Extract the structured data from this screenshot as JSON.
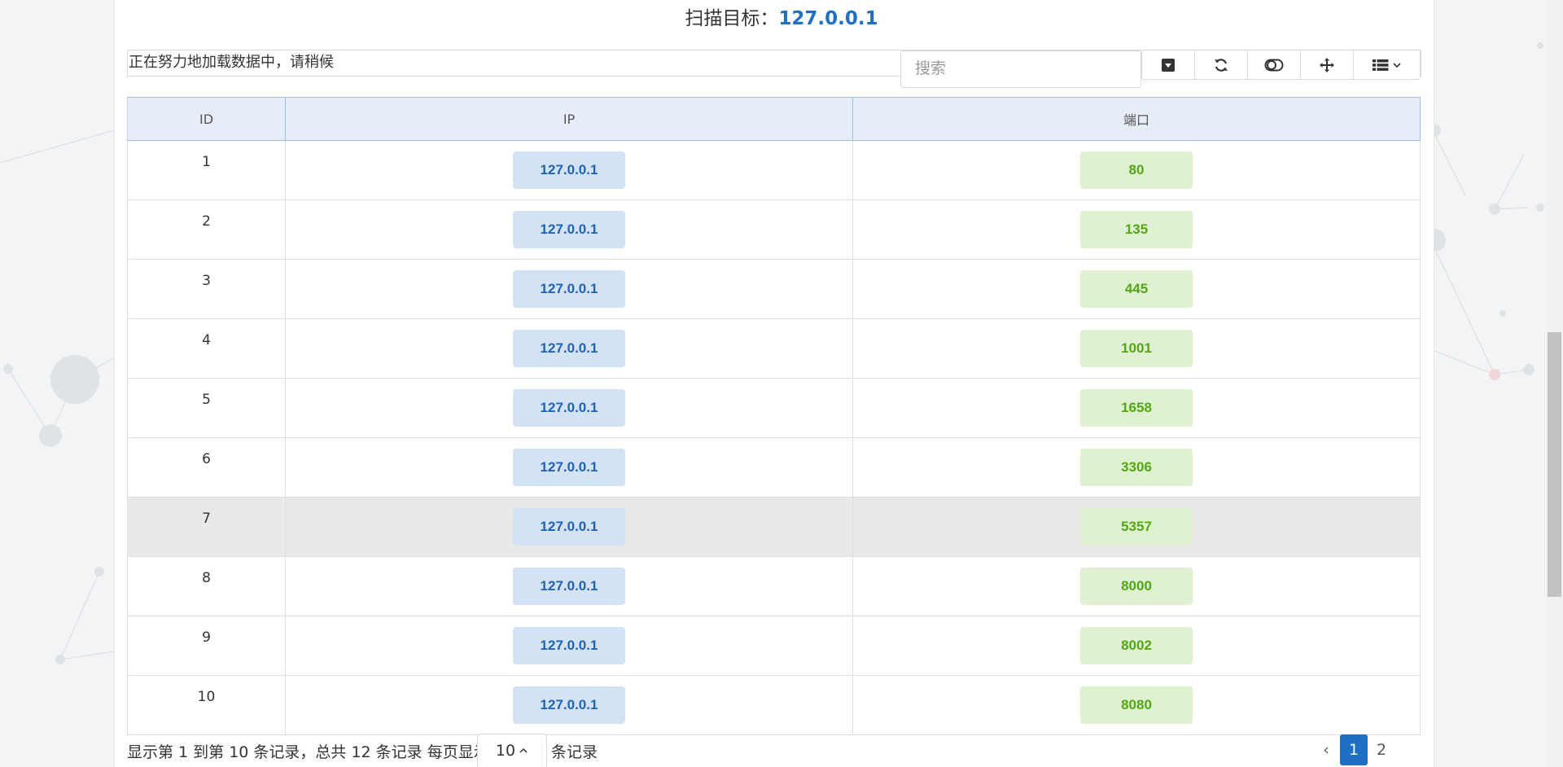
{
  "header": {
    "title_prefix": "扫描目标：",
    "title_target": "127.0.0.1"
  },
  "loading_text": "正在努力地加载数据中，请稍候",
  "search": {
    "placeholder": "搜索"
  },
  "toolbar": {
    "buttons": [
      "caret-square-down-icon",
      "refresh-icon",
      "toggle-icon",
      "move-icon",
      "columns-list-icon"
    ]
  },
  "table": {
    "headers": [
      "ID",
      "IP",
      "端口"
    ],
    "rows": [
      {
        "id": "1",
        "ip": "127.0.0.1",
        "port": "80"
      },
      {
        "id": "2",
        "ip": "127.0.0.1",
        "port": "135"
      },
      {
        "id": "3",
        "ip": "127.0.0.1",
        "port": "445"
      },
      {
        "id": "4",
        "ip": "127.0.0.1",
        "port": "1001"
      },
      {
        "id": "5",
        "ip": "127.0.0.1",
        "port": "1658"
      },
      {
        "id": "6",
        "ip": "127.0.0.1",
        "port": "3306"
      },
      {
        "id": "7",
        "ip": "127.0.0.1",
        "port": "5357"
      },
      {
        "id": "8",
        "ip": "127.0.0.1",
        "port": "8000"
      },
      {
        "id": "9",
        "ip": "127.0.0.1",
        "port": "8002"
      },
      {
        "id": "10",
        "ip": "127.0.0.1",
        "port": "8080"
      }
    ],
    "highlighted_row_index": 6
  },
  "footer": {
    "summary": "显示第 1 到第 10 条记录，总共 12 条记录 每页显示",
    "page_size": "10",
    "suffix": "条记录"
  },
  "pagination": {
    "prev": "‹",
    "pages": [
      "1",
      "2"
    ],
    "current": "1"
  },
  "colors": {
    "accent": "#1f6fc5",
    "ip_tag_bg": "#d3e2f5",
    "port_tag_bg": "#e0f1d1",
    "port_text": "#52a814"
  }
}
